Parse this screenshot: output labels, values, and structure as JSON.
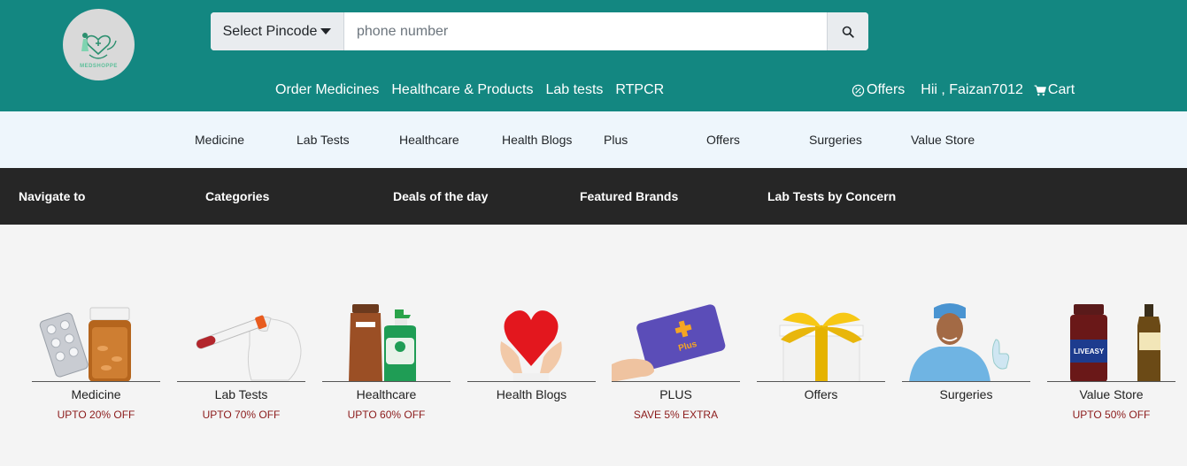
{
  "header": {
    "logo_text": "MEDSHOPPE",
    "pincode_label": "Select Pincode",
    "search_placeholder": "phone number",
    "main_nav": [
      "Order Medicines",
      "Healthcare & Products",
      "Lab tests",
      "RTPCR"
    ],
    "offers_label": "Offers",
    "greeting": "Hii , Faizan7012",
    "cart_label": "Cart"
  },
  "subnav": [
    "Medicine",
    "Lab Tests",
    "Healthcare",
    "Health Blogs",
    "Plus",
    "Offers",
    "Surgeries",
    "Value Store"
  ],
  "darkbar": [
    "Navigate to",
    "Categories",
    "Deals of the day",
    "Featured Brands",
    "Lab Tests by Concern"
  ],
  "cards": [
    {
      "name": "Medicine",
      "offer": "UPTO 20% OFF",
      "icon": "medicine-bottle-icon"
    },
    {
      "name": "Lab Tests",
      "offer": "UPTO 70% OFF",
      "icon": "test-tube-icon"
    },
    {
      "name": "Healthcare",
      "offer": "UPTO 60% OFF",
      "icon": "healthcare-products-icon"
    },
    {
      "name": "Health Blogs",
      "offer": "",
      "icon": "heart-hands-icon"
    },
    {
      "name": "PLUS",
      "offer": "SAVE 5% EXTRA",
      "icon": "plus-card-icon",
      "card_text": "Plus"
    },
    {
      "name": "Offers",
      "offer": "",
      "icon": "gift-box-icon"
    },
    {
      "name": "Surgeries",
      "offer": "",
      "icon": "surgeon-icon"
    },
    {
      "name": "Value Store",
      "offer": "UPTO 50% OFF",
      "icon": "value-store-bottles-icon",
      "product_text": "LIVEASY"
    }
  ],
  "colors": {
    "header_bg": "#138781",
    "subnav_bg": "#eef6fc",
    "darkbar_bg": "#262626",
    "offer_text": "#8b1a1a"
  }
}
